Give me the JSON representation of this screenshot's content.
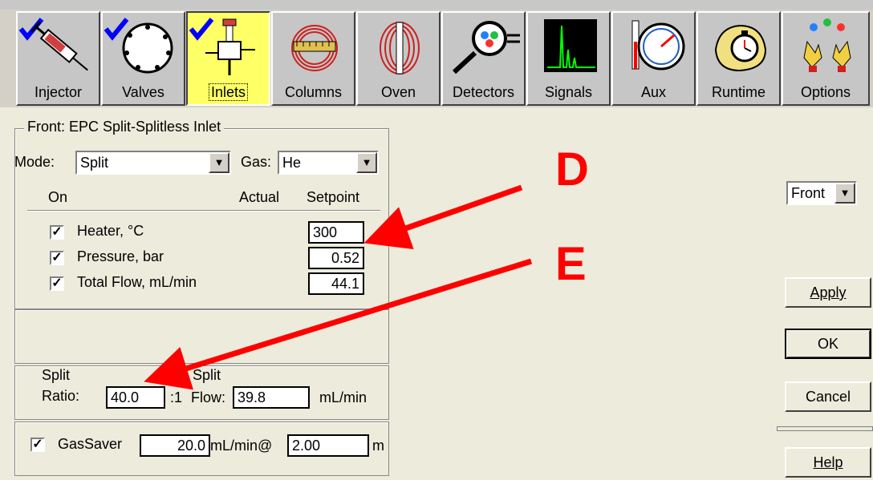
{
  "toolbar": {
    "buttons": [
      {
        "label": "Injector",
        "checked": true,
        "active": false,
        "icon": "syringe-icon"
      },
      {
        "label": "Valves",
        "checked": true,
        "active": false,
        "icon": "valve-icon"
      },
      {
        "label": "Inlets",
        "checked": true,
        "active": true,
        "icon": "inlet-icon"
      },
      {
        "label": "Columns",
        "checked": false,
        "active": false,
        "icon": "column-coil-icon"
      },
      {
        "label": "Oven",
        "checked": false,
        "active": false,
        "icon": "oven-icon"
      },
      {
        "label": "Detectors",
        "checked": false,
        "active": false,
        "icon": "magnifier-icon"
      },
      {
        "label": "Signals",
        "checked": false,
        "active": false,
        "icon": "signal-chart-icon"
      },
      {
        "label": "Aux",
        "checked": false,
        "active": false,
        "icon": "gauge-icon"
      },
      {
        "label": "Runtime",
        "checked": false,
        "active": false,
        "icon": "stopwatch-icon"
      },
      {
        "label": "Options",
        "checked": false,
        "active": false,
        "icon": "options-icon"
      }
    ]
  },
  "inlet": {
    "group_title": "Front: EPC Split-Splitless Inlet",
    "mode_label": "Mode:",
    "mode_value": "Split",
    "gas_label": "Gas:",
    "gas_value": "He",
    "col_on": "On",
    "col_actual": "Actual",
    "col_setpoint": "Setpoint",
    "params": [
      {
        "label": "Heater, °C",
        "checked": true,
        "setpoint": "300"
      },
      {
        "label": "Pressure,  bar",
        "checked": true,
        "setpoint": "0.52"
      },
      {
        "label": "Total Flow, mL/min",
        "checked": true,
        "setpoint": "44.1"
      }
    ],
    "split_ratio_label_1": "Split",
    "split_ratio_label_2": "Ratio:",
    "split_ratio_value": "40.0",
    "split_ratio_suffix": ":1",
    "split_flow_label_1": "Split",
    "split_flow_label_2": "Flow:",
    "split_flow_value": "39.8",
    "split_flow_unit": "mL/min",
    "gassaver_label": "GasSaver",
    "gassaver_checked": true,
    "gassaver_flow": "20.0",
    "gassaver_flow_unit": "mL/min@",
    "gassaver_time": "2.00",
    "gassaver_time_unit": "m"
  },
  "side": {
    "location_value": "Front",
    "apply_label": "Apply",
    "ok_label": "OK",
    "cancel_label": "Cancel",
    "help_label": "Help"
  },
  "annotations": {
    "d_label": "D",
    "e_label": "E",
    "arrow_color": "#ff0000"
  }
}
